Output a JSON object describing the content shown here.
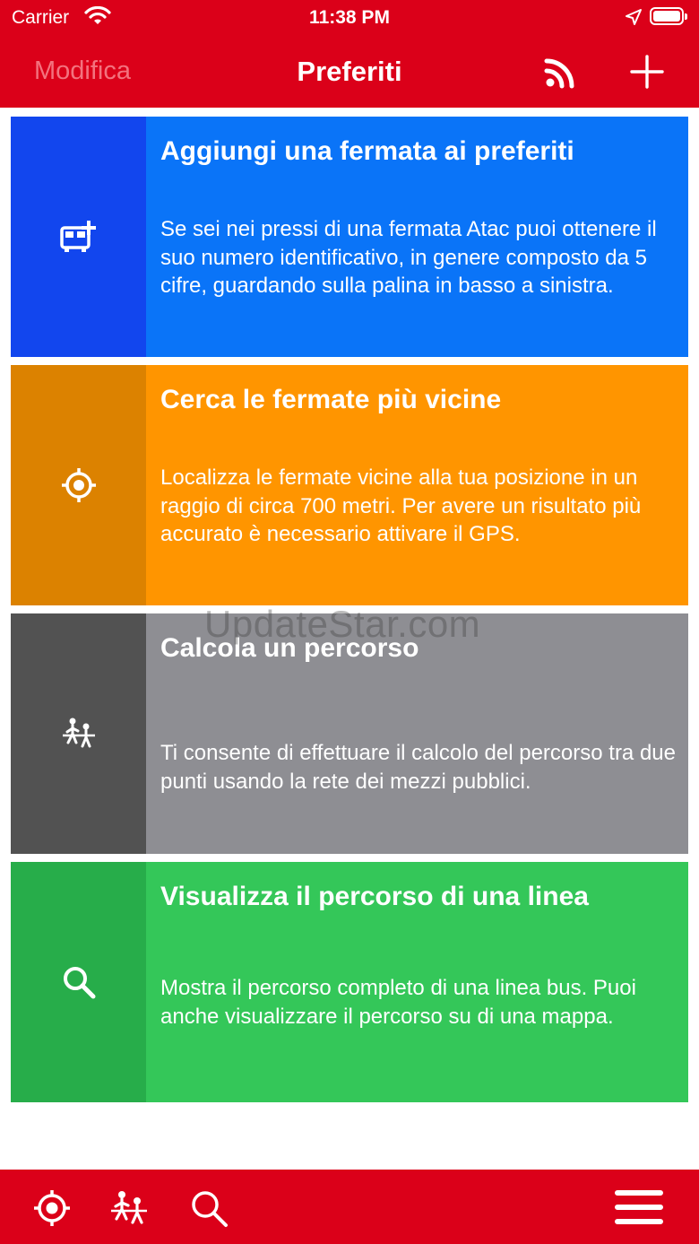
{
  "status_bar": {
    "carrier": "Carrier",
    "time": "11:38 PM"
  },
  "nav_bar": {
    "edit_label": "Modifica",
    "title": "Preferiti",
    "icons": [
      "rss-icon",
      "plus-icon"
    ]
  },
  "cards": [
    {
      "title": "Aggiungi una fermata ai preferiti",
      "description": "Se sei nei pressi di una fermata Atac puoi ottenere il suo numero identificativo, in genere composto da 5 cifre, guardando sulla palina in basso a sinistra.",
      "icon": "bus-add-icon",
      "color": "#0A74F8",
      "side_color": "#1246EE"
    },
    {
      "title": "Cerca le fermate più vicine",
      "description": "Localizza le fermate vicine alla tua posizione in un raggio di circa 700 metri. Per avere un risultato più accurato è necessario attivare il GPS.",
      "icon": "locate-icon",
      "color": "#FF9500",
      "side_color": "#DC8200"
    },
    {
      "title": "Calcola un percorso",
      "description": "Ti consente di effettuare il calcolo del percorso tra due punti usando la rete dei mezzi pubblici.",
      "icon": "route-icon",
      "color": "#8E8E93",
      "side_color": "#525252"
    },
    {
      "title": "Visualizza il percorso di una linea",
      "description": "Mostra il percorso completo di una linea bus. Puoi anche visualizzare il percorso su di una mappa.",
      "icon": "search-icon",
      "color": "#34C759",
      "side_color": "#27AD4A"
    }
  ],
  "watermark": "UpdateStar.com",
  "tab_bar": {
    "items": [
      "locate-icon",
      "route-icon",
      "search-icon",
      "menu-icon"
    ]
  },
  "colors": {
    "accent": "#DB0019"
  }
}
